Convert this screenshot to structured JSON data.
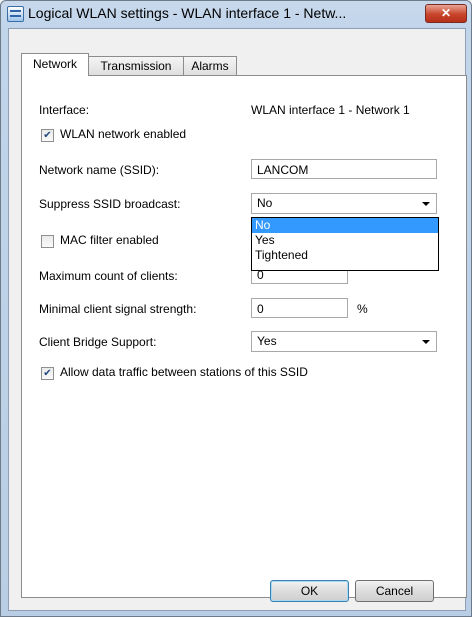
{
  "window": {
    "title": "Logical WLAN settings - WLAN interface 1 - Netw..."
  },
  "tabs": [
    {
      "label": "Network"
    },
    {
      "label": "Transmission"
    },
    {
      "label": "Alarms"
    }
  ],
  "form": {
    "interface_label": "Interface:",
    "interface_value": "WLAN interface 1 - Network 1",
    "wlan_enabled_label": "WLAN network enabled",
    "wlan_enabled": true,
    "ssid_label": "Network name (SSID):",
    "ssid_value": "LANCOM",
    "suppress_label": "Suppress SSID broadcast:",
    "suppress_value": "No",
    "suppress_options": [
      "No",
      "Yes",
      "Tightened"
    ],
    "mac_filter_label": "MAC filter enabled",
    "mac_filter": false,
    "max_clients_label": "Maximum count of clients:",
    "max_clients_value": "0",
    "min_signal_label": "Minimal client signal strength:",
    "min_signal_value": "0",
    "min_signal_unit": "%",
    "bridge_label": "Client Bridge Support:",
    "bridge_value": "Yes",
    "allow_traffic_label": "Allow data traffic between stations of this SSID",
    "allow_traffic": true
  },
  "buttons": {
    "ok": "OK",
    "cancel": "Cancel"
  },
  "icons": {
    "app": "wlan-settings-icon",
    "close": "close-icon"
  }
}
